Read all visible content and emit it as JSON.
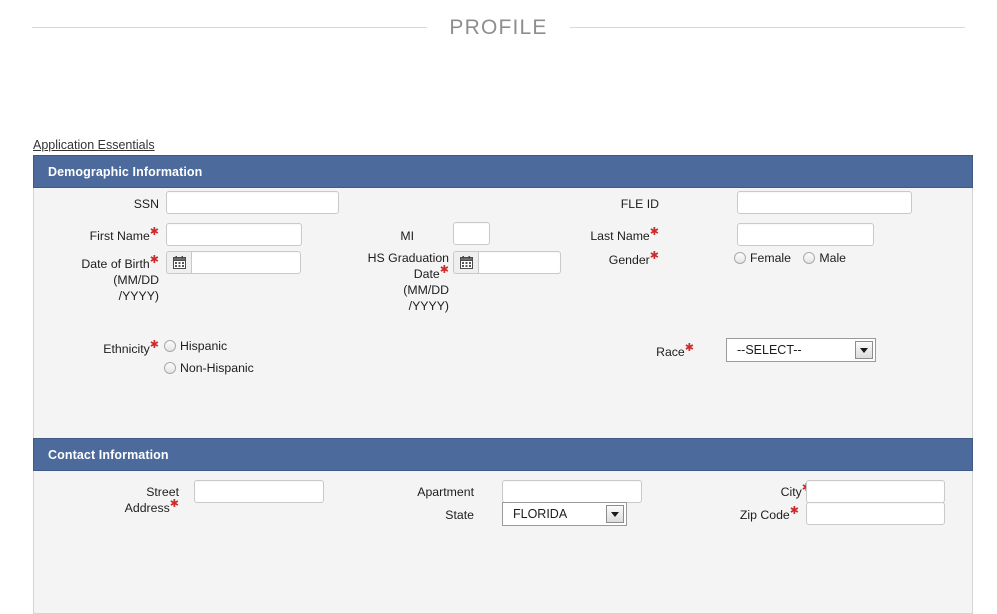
{
  "page": {
    "title": "PROFILE"
  },
  "breadcrumb": {
    "link": "Application Essentials"
  },
  "colors": {
    "panel_header_bg": "#4c6a9c",
    "panel_body_bg": "#f4f4f4",
    "required_marker": "#cc2b2b",
    "title_text": "#8e8e8e"
  },
  "sections": {
    "demographic": {
      "header": "Demographic Information",
      "fields": {
        "ssn": {
          "label": "SSN",
          "value": "",
          "required": false
        },
        "fle_id": {
          "label": "FLE ID",
          "value": "",
          "required": false
        },
        "first_name": {
          "label": "First Name",
          "value": "",
          "required": true
        },
        "mi": {
          "label": "MI",
          "value": "",
          "required": false
        },
        "last_name": {
          "label": "Last Name",
          "value": "",
          "required": true
        },
        "date_of_birth": {
          "label": "Date of Birth",
          "format_line1": "(MM/DD",
          "format_line2": "/YYYY)",
          "value": "",
          "required": true
        },
        "hs_graduation_date": {
          "label_line1": "HS Graduation",
          "label_line2": "Date",
          "format_line1": "(MM/DD",
          "format_line2": "/YYYY)",
          "value": "",
          "required": true
        },
        "gender": {
          "label": "Gender",
          "required": true,
          "options": [
            "Female",
            "Male"
          ],
          "selected": ""
        },
        "ethnicity": {
          "label": "Ethnicity",
          "required": true,
          "options": [
            "Hispanic",
            "Non-Hispanic"
          ],
          "selected": ""
        },
        "race": {
          "label": "Race",
          "required": true,
          "selected": "--SELECT--"
        }
      }
    },
    "contact": {
      "header": "Contact Information",
      "fields": {
        "street_address": {
          "label_line1": "Street",
          "label_line2": "Address",
          "value": "",
          "required": true
        },
        "apartment": {
          "label": "Apartment",
          "value": "",
          "required": false
        },
        "city": {
          "label": "City",
          "value": "",
          "required": true
        },
        "state": {
          "label": "State",
          "selected": "FLORIDA",
          "required": false
        },
        "zip_code": {
          "label": "Zip Code",
          "value": "",
          "required": true
        }
      }
    }
  },
  "icons": {
    "calendar": "calendar-icon",
    "dropdown_caret": "chevron-down-icon"
  }
}
